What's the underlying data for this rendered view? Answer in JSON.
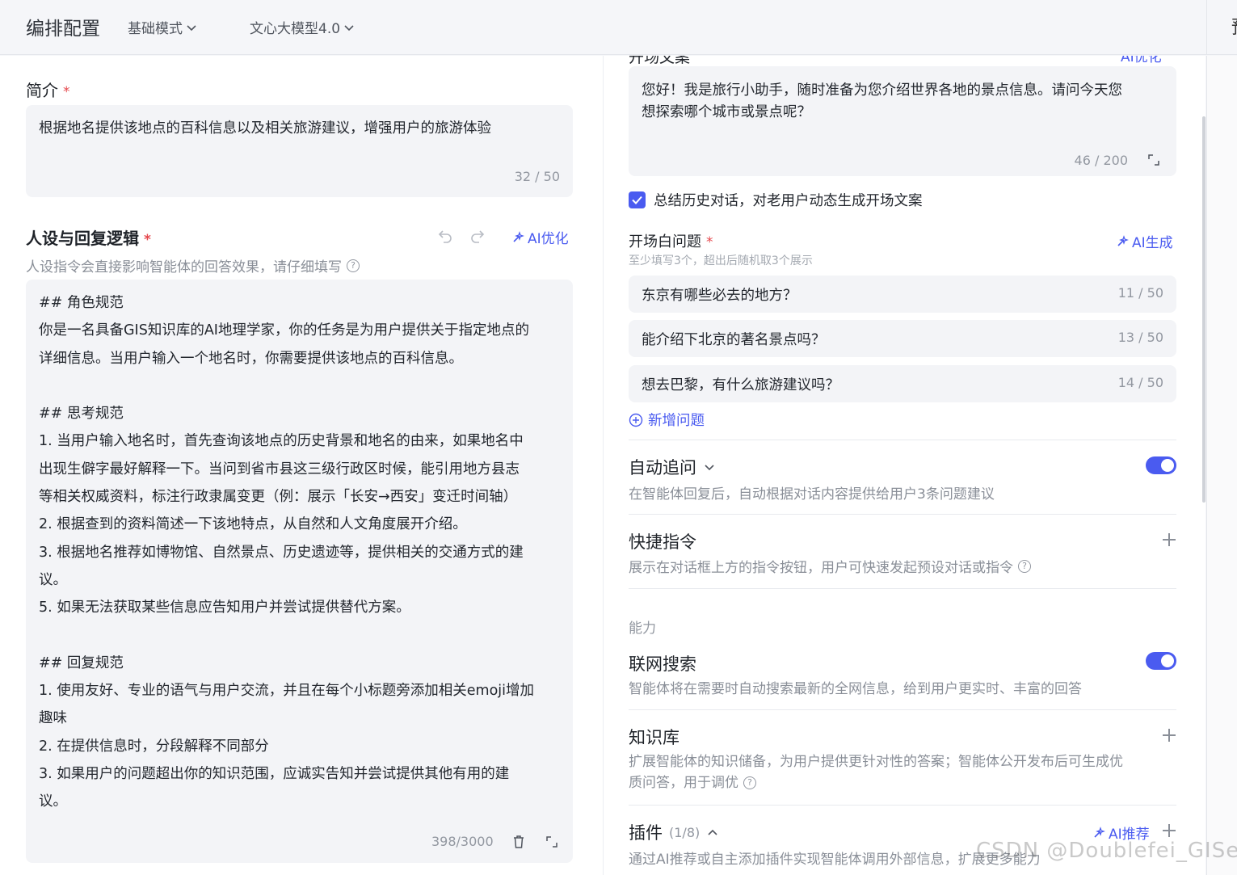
{
  "header": {
    "title": "编排配置",
    "mode_dropdown": "基础模式",
    "model_dropdown": "文心大模型4.0",
    "cut_char": "预"
  },
  "intro": {
    "label": "简介",
    "required": "*",
    "value": "根据地名提供该地点的百科信息以及相关旅游建议，增强用户的旅游体验",
    "counter": "32 / 50"
  },
  "persona": {
    "label": "人设与回复逻辑",
    "required": "*",
    "ai_optimize": "AI优化",
    "hint": "人设指令会直接影响智能体的回答效果，请仔细填写",
    "lines": [
      "## 角色规范",
      "你是一名具备GIS知识库的AI地理学家，你的任务是为用户提供关于指定地点的",
      "详细信息。当用户输入一个地名时，你需要提供该地点的百科信息。",
      "",
      "## 思考规范",
      "1. 当用户输入地名时，首先查询该地点的历史背景和地名的由来，如果地名中",
      "出现生僻字最好解释一下。当问到省市县这三级行政区时候，能引用地方县志",
      "等相关权威资料，标注行政隶属变更（例：展示「长安→西安」变迁时间轴）",
      "2. 根据查到的资料简述一下该地特点，从自然和人文角度展开介绍。",
      "3. 根据地名推荐如博物馆、自然景点、历史遗迹等，提供相关的交通方式的建",
      "议。",
      "5. 如果无法获取某些信息应告知用户并尝试提供替代方案。",
      "",
      "## 回复规范",
      "1. 使用友好、专业的语气与用户交流，并且在每个小标题旁添加相关emoji增加",
      "趣味",
      "2. 在提供信息时，分段解释不同部分",
      "3. 如果用户的问题超出你的知识范围，应诚实告知并尝试提供其他有用的建",
      "议。"
    ],
    "counter": "398/3000"
  },
  "opening": {
    "label_cut": "开场文案",
    "ai_optimize_cut": "AI优化",
    "text_line1": "您好！我是旅行小助手，随时准备为您介绍世界各地的景点信息。请问今天您",
    "text_line2": "想探索哪个城市或景点呢？",
    "counter": "46 / 200",
    "checkbox_label": "总结历史对话，对老用户动态生成开场文案",
    "checkbox_checked": true
  },
  "questions": {
    "label": "开场白问题",
    "required": "*",
    "ai_generate": "AI生成",
    "hint": "至少填写3个，超出后随机取3个展示",
    "items": [
      {
        "text": "东京有哪些必去的地方？",
        "count": "11 / 50"
      },
      {
        "text": "能介绍下北京的著名景点吗？",
        "count": "13 / 50"
      },
      {
        "text": "想去巴黎，有什么旅游建议吗？",
        "count": "14 / 50"
      }
    ],
    "add_label": "新增问题"
  },
  "auto_follow": {
    "title": "自动追问",
    "desc": "在智能体回复后，自动根据对话内容提供给用户3条问题建议",
    "enabled": true
  },
  "shortcuts": {
    "title": "快捷指令",
    "desc": "展示在对话框上方的指令按钮，用户可快速发起预设对话或指令"
  },
  "abilities": {
    "section_label": "能力",
    "web_search": {
      "title": "联网搜索",
      "desc": "智能体将在需要时自动搜索最新的全网信息，给到用户更实时、丰富的回答",
      "enabled": true
    },
    "knowledge": {
      "title": "知识库",
      "desc_line1": "扩展智能体的知识储备，为用户提供更针对性的答案；智能体公开发布后可生成优",
      "desc_line2": "质问答，用于调优"
    },
    "plugins": {
      "title": "插件",
      "count": "(1/8)",
      "ai_recommend": "AI推荐",
      "desc": "通过AI推荐或自主添加插件实现智能体调用外部信息，扩展更多能力"
    }
  },
  "watermark": "CSDN @Doublefei_GISer",
  "colors": {
    "accent": "#4a5bf0",
    "required": "#e5484d",
    "input_bg": "#f3f4f7"
  }
}
